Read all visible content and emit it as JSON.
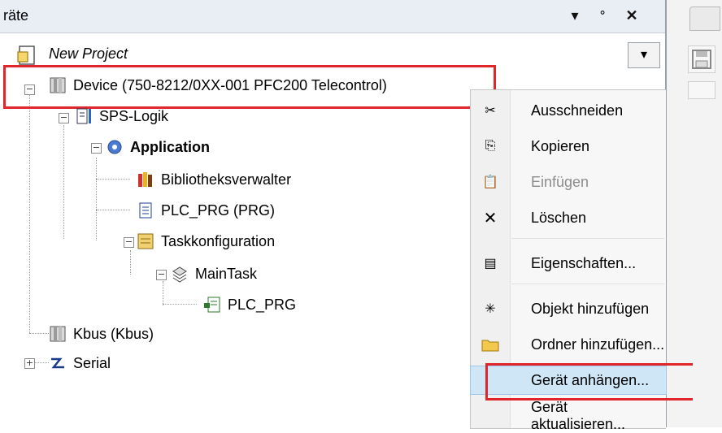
{
  "titlebar": {
    "title": "räte",
    "btn_dropdown": "▾",
    "btn_pin": "ᐤ",
    "btn_close": "✕"
  },
  "project": {
    "label": "New Project",
    "dropdown": "▾"
  },
  "tree": {
    "device": "Device (750-8212/0XX-001 PFC200 Telecontrol)",
    "sps": "SPS-Logik",
    "application": "Application",
    "bibliothek": "Bibliotheksverwalter",
    "plc_prg": "PLC_PRG (PRG)",
    "taskkonfig": "Taskkonfiguration",
    "maintask": "MainTask",
    "plc_prg2": "PLC_PRG",
    "kbus": "Kbus (Kbus)",
    "serial": "Serial"
  },
  "expanders": {
    "minus": "−",
    "plus": "+"
  },
  "context_menu": {
    "items": [
      {
        "label": "Ausschneiden",
        "icon": "scissors-icon"
      },
      {
        "label": "Kopieren",
        "icon": "copy-icon"
      },
      {
        "label": "Einfügen",
        "icon": "paste-icon"
      },
      {
        "label": "Löschen",
        "icon": "delete-icon"
      },
      {
        "label": "Eigenschaften...",
        "icon": "properties-icon"
      },
      {
        "label": "Objekt hinzufügen",
        "icon": "add-object-icon"
      },
      {
        "label": "Ordner hinzufügen...",
        "icon": "folder-icon"
      },
      {
        "label": "Gerät anhängen...",
        "icon": ""
      },
      {
        "label": "Gerät aktualisieren...",
        "icon": ""
      }
    ]
  },
  "colors": {
    "highlight": "#e0252b",
    "hover": "#cfe6f7"
  }
}
